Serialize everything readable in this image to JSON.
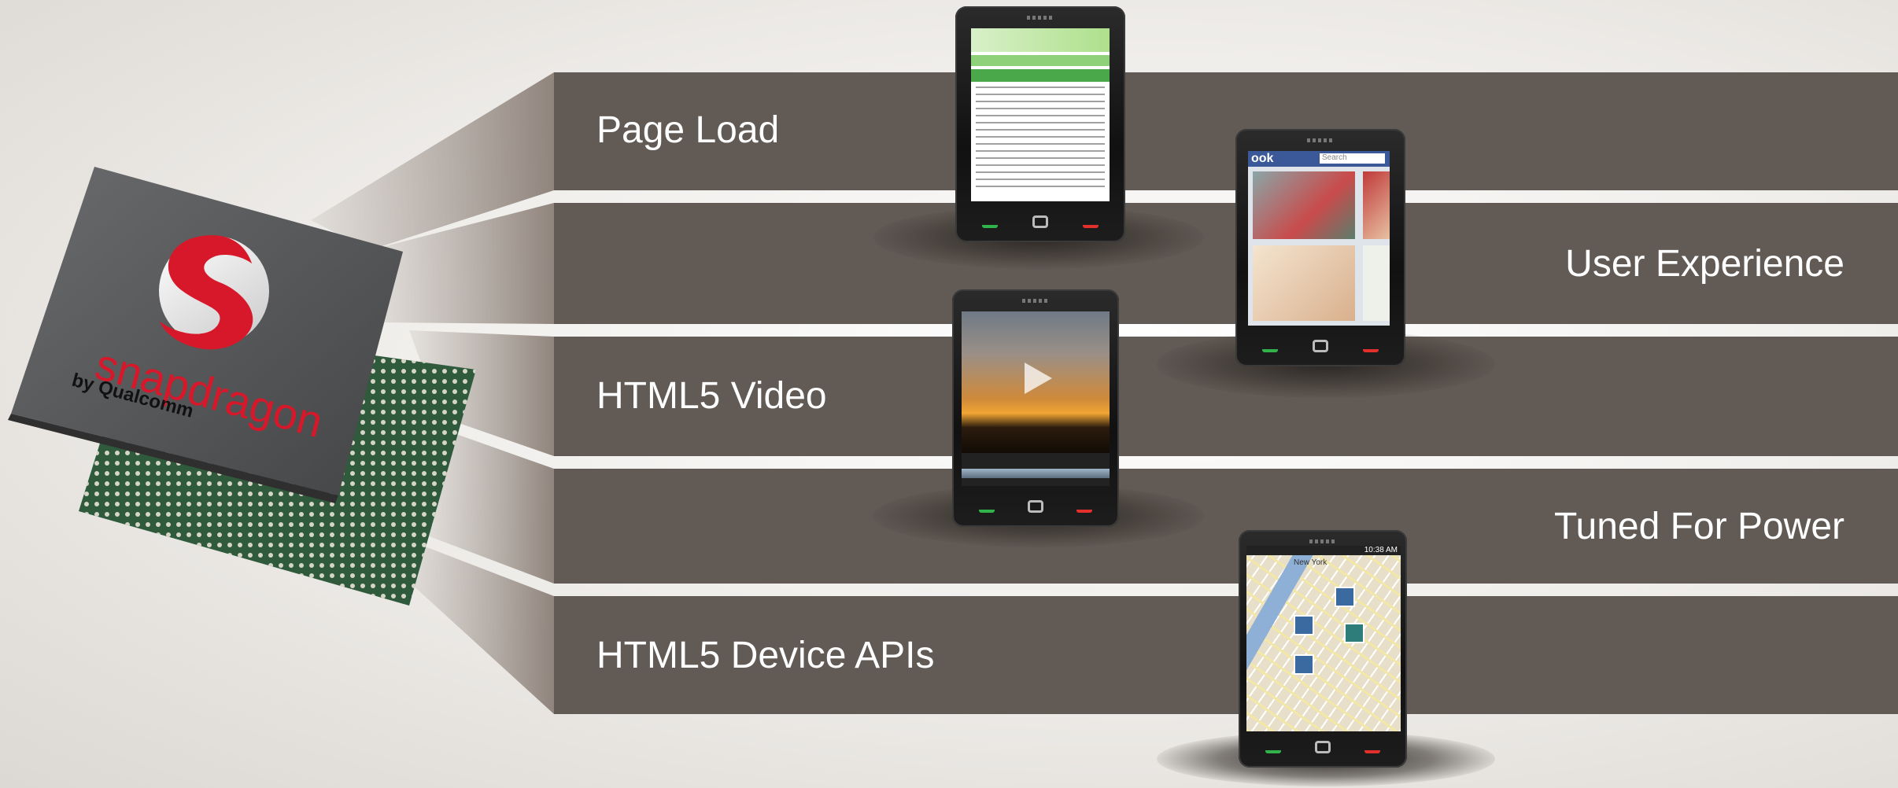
{
  "bands": {
    "page_load": "Page Load",
    "user_experience": "User Experience",
    "html5_video": "HTML5 Video",
    "tuned_for_power": "Tuned For Power",
    "html5_device_apis": "HTML5 Device APIs"
  },
  "chip": {
    "brand": "snapdragon",
    "maker": "by Qualcomm"
  },
  "phones": {
    "social": {
      "site_logo": "ook",
      "search_placeholder": "Search"
    },
    "map": {
      "city": "New York",
      "clock": "10:38 AM"
    }
  },
  "colors": {
    "band": "#625a55",
    "logo_red": "#d7182a",
    "chip_body": "#58595b",
    "board_green": "#2f5a3c"
  }
}
